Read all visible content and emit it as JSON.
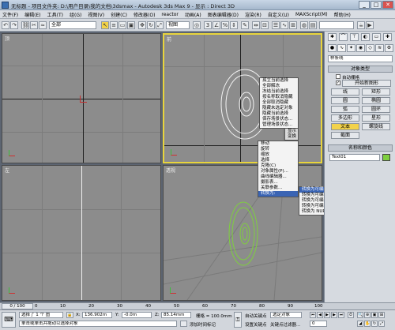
{
  "window": {
    "title": "无标题 - 项目文件夹: D:\\用户目录\\我的文档\\3dsmax - Autodesk 3ds Max 9 - 显示 : Direct 3D",
    "minimize": "_",
    "maximize": "□",
    "close": "✕"
  },
  "menu": [
    "文件(F)",
    "编辑(E)",
    "工具(T)",
    "组(G)",
    "视图(V)",
    "创建(C)",
    "修改器(O)",
    "reactor",
    "动画(A)",
    "图表编辑器(D)",
    "渲染(R)",
    "自定义(U)",
    "MAXScript(M)",
    "帮助(H)"
  ],
  "toolbar": {
    "selection_filter": "全部",
    "view_dropdown": "视图"
  },
  "viewports": {
    "top": "顶",
    "front": "前",
    "left": "左",
    "perspective": "透视"
  },
  "context_menu": {
    "items_top": [
      "孤立当前选择",
      "全部解冻",
      "冻结当前选择",
      "按名称取消隐藏",
      "全部取消隐藏",
      "隐藏未选定对象",
      "隐藏当前选择",
      "保存场景状态...",
      "管理场景状态..."
    ],
    "quad_labels": [
      "显示",
      "变换"
    ],
    "items_bottom": [
      "移动",
      "旋转",
      "缩放",
      "选择",
      "克隆(C)",
      "对象属性(P)...",
      "曲线编辑器...",
      "摄影表...",
      "关联参数...",
      "转换为:"
    ],
    "submenu": [
      "转换为可编辑网格",
      "转换为可编辑多边形",
      "转换为可编辑面片",
      "转换为 NURBS"
    ],
    "submenu_items": [
      "转换为可编辑样条线",
      "转换为可编辑网格",
      "转换为可编辑多边形",
      "转换为可编辑面片",
      "转换为 NURBS"
    ]
  },
  "command_panel": {
    "category_dropdown": "样条线",
    "object_type_header": "对象类型",
    "auto_grid": "自动栅格",
    "start_new_shape": "开始新图形",
    "buttons": [
      "线",
      "矩形",
      "圆",
      "椭圆",
      "弧",
      "圆环",
      "多边形",
      "星形",
      "文本",
      "螺旋线",
      "截面"
    ],
    "name_color_header": "名称和颜色",
    "object_name": "Text01"
  },
  "timeline": {
    "slider_label": "0 / 100",
    "ticks": [
      "0",
      "10",
      "20",
      "30",
      "40",
      "50",
      "60",
      "70",
      "80",
      "90",
      "100"
    ]
  },
  "status": {
    "selection_text": "选择了 1 个 图",
    "x_label": "X:",
    "x_value": "136.902m",
    "y_label": "Y:",
    "y_value": "-0.0m",
    "z_label": "Z:",
    "z_value": "85.14mm",
    "grid_label": "栅格 = 100.0mm",
    "prompt": "单击或单击并拖动以选择对象",
    "add_time_tag": "添加时间标记",
    "auto_key": "自动关键点",
    "set_key": "设置关键点",
    "selected_dropdown": "选定对象",
    "key_filters": "关键点过滤器...",
    "frame_value": "0"
  },
  "colors": {
    "active_viewport_border": "#e8d43c",
    "object_color": "#7fcf3f",
    "viewport_bg": "#8c8c8c"
  }
}
